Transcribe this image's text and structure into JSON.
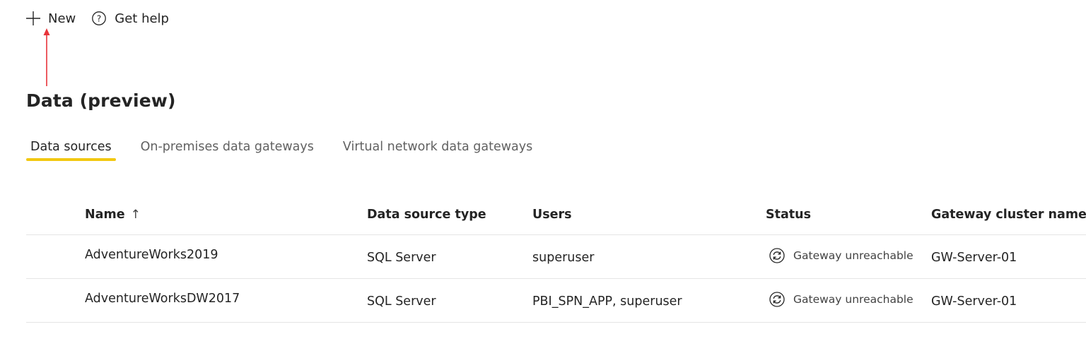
{
  "toolbar": {
    "new_label": "New",
    "help_label": "Get help",
    "new_icon": "plus-icon",
    "help_icon": "question-circle-icon"
  },
  "page_title": "Data (preview)",
  "tabs": [
    {
      "label": "Data sources",
      "active": true
    },
    {
      "label": "On-premises data gateways",
      "active": false
    },
    {
      "label": "Virtual network data gateways",
      "active": false
    }
  ],
  "table": {
    "columns": {
      "name": "Name",
      "name_sort": "↑",
      "type": "Data source type",
      "users": "Users",
      "status": "Status",
      "gateway": "Gateway cluster name"
    },
    "rows": [
      {
        "name": "AdventureWorks2019",
        "type": "SQL Server",
        "users": "superuser",
        "status": "Gateway unreachable",
        "status_icon": "sync-icon",
        "gateway": "GW-Server-01"
      },
      {
        "name": "AdventureWorksDW2017",
        "type": "SQL Server",
        "users": "PBI_SPN_APP, superuser",
        "status": "Gateway unreachable",
        "status_icon": "sync-icon",
        "gateway": "GW-Server-01"
      }
    ]
  },
  "colors": {
    "accent": "#f2c811",
    "annotation": "#e8343a",
    "text": "#242424",
    "muted": "#616161",
    "divider": "#e5e5e5"
  }
}
